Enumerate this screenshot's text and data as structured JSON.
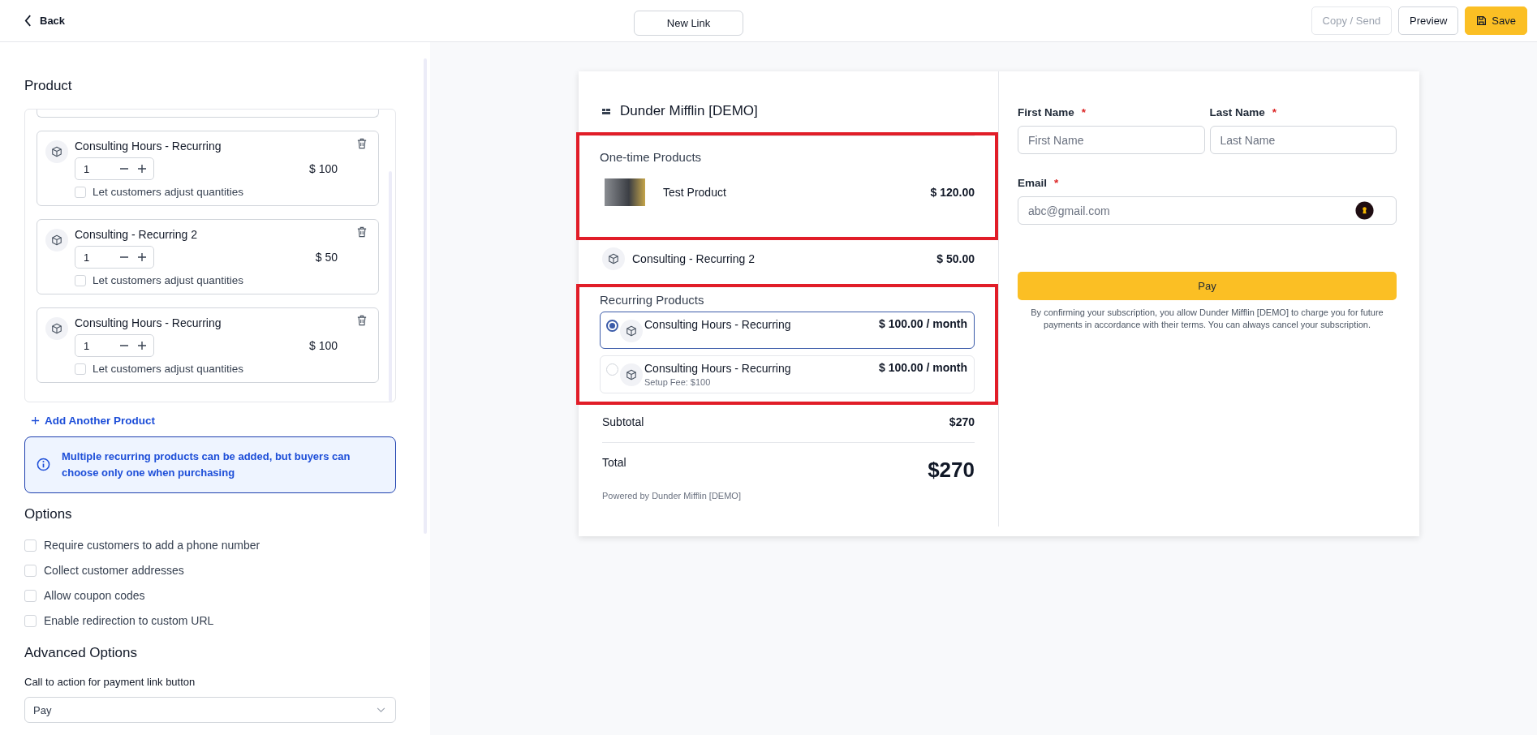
{
  "topbar": {
    "back": "Back",
    "link_name": "New Link",
    "buttons": [
      {
        "label": "Copy / Send",
        "kind": "secondary",
        "disabled": true
      },
      {
        "label": "Preview",
        "kind": "secondary",
        "disabled": false
      },
      {
        "label": "Save",
        "kind": "primary",
        "disabled": false
      }
    ]
  },
  "editor": {
    "product_heading": "Product",
    "products": [
      {
        "name": "Consulting Hours - Recurring",
        "quantity": "1",
        "price": "$ 100",
        "adjust_label": "Let customers adjust quantities",
        "adjust_checked": false
      },
      {
        "name": "Consulting - Recurring 2",
        "quantity": "1",
        "price": "$ 50",
        "adjust_label": "Let customers adjust quantities",
        "adjust_checked": false
      },
      {
        "name": "Consulting Hours - Recurring",
        "quantity": "1",
        "price": "$ 100",
        "adjust_label": "Let customers adjust quantities",
        "adjust_checked": false
      }
    ],
    "add_product": "Add Another Product",
    "info": "Multiple recurring products can be added, but buyers can choose only one when purchasing",
    "options_heading": "Options",
    "options": [
      {
        "label": "Require customers to add a phone number",
        "checked": false
      },
      {
        "label": "Collect customer addresses",
        "checked": false
      },
      {
        "label": "Allow coupon codes",
        "checked": false
      },
      {
        "label": "Enable redirection to custom URL",
        "checked": false
      }
    ],
    "advanced_heading": "Advanced Options",
    "cta_label": "Call to action for payment link button",
    "cta_value": "Pay"
  },
  "preview": {
    "merchant": "Dunder Mifflin [DEMO]",
    "one_time": {
      "heading": "One-time Products",
      "highlighted": true,
      "items": [
        {
          "name": "Test Product",
          "price": "$ 120.00",
          "kind": "photo"
        }
      ]
    },
    "other_items": [
      {
        "name": "Consulting - Recurring 2",
        "price": "$ 50.00",
        "kind": "icon"
      }
    ],
    "recurring": {
      "heading": "Recurring Products",
      "highlighted": true,
      "items": [
        {
          "name": "Consulting Hours - Recurring",
          "price": "$ 100.00 / month",
          "selected": true
        },
        {
          "name": "Consulting Hours - Recurring",
          "price": "$ 100.00 / month",
          "note": "Setup Fee: $100",
          "selected": false
        }
      ]
    },
    "subtotal_label": "Subtotal",
    "subtotal": "$270",
    "total_label": "Total",
    "total": "$270",
    "powered_by": "Powered by Dunder Mifflin [DEMO]"
  },
  "form": {
    "fields": [
      {
        "label": "First Name",
        "required_mark": "*",
        "placeholder": "First Name",
        "kind": "name"
      },
      {
        "label": "Last Name",
        "required_mark": "*",
        "placeholder": "Last Name",
        "kind": "name"
      },
      {
        "label": "Email",
        "required_mark": "*",
        "placeholder": "abc@gmail.com",
        "kind": "email"
      }
    ],
    "pay_button": "Pay",
    "disclaimer": "By confirming your subscription, you allow Dunder Mifflin [DEMO] to charge you for future payments in accordance with their terms. You can always cancel your subscription."
  }
}
